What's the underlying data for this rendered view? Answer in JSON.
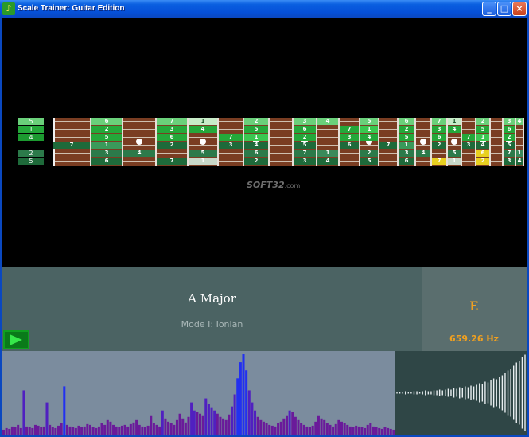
{
  "window": {
    "title": "Scale Trainer: Guitar Edition",
    "minimize": "_",
    "maximize": "□",
    "close": "×",
    "icon": "trainer-app-icon"
  },
  "scale": {
    "name": "A Major",
    "mode": "Mode I: Ionian"
  },
  "note": {
    "letter": "E",
    "frequency": "659.26 Hz"
  },
  "watermark": {
    "brand": "SOFT32",
    "suffix": ".com"
  },
  "legend": [
    "5",
    "1",
    "4",
    "",
    "2",
    "5"
  ],
  "fret_positions": [
    0,
    48,
    88,
    130,
    170,
    208,
    240,
    272,
    302,
    332,
    360,
    386,
    410,
    434,
    456,
    476,
    496,
    514,
    532,
    550,
    566,
    582,
    592
  ],
  "fretboard": [
    [
      "5",
      "",
      "6",
      "",
      "7",
      "1",
      "",
      "2",
      "",
      "3",
      "4",
      "",
      "5",
      "",
      "6",
      "",
      "7",
      "1",
      "",
      "2",
      "",
      "3",
      "4"
    ],
    [
      "1",
      "",
      "2",
      "",
      "3",
      "4",
      "",
      "5",
      "",
      "6",
      "",
      "7",
      "1",
      "",
      "2",
      "",
      "3",
      "4",
      "",
      "5",
      "",
      "6",
      ""
    ],
    [
      "4",
      "",
      "5",
      "",
      "6",
      "",
      "7",
      "1",
      "",
      "2",
      "",
      "3",
      "4",
      "",
      "5",
      "",
      "6",
      "",
      "7",
      "1",
      "",
      "2",
      ""
    ],
    [
      "",
      "7",
      "1",
      "",
      "2",
      "",
      "3",
      "4",
      "",
      "5",
      "",
      "6",
      "",
      "7",
      "1",
      "",
      "2",
      "",
      "3",
      "4",
      "",
      "5",
      ""
    ],
    [
      "2",
      "",
      "3",
      "4",
      "",
      "5",
      "",
      "6",
      "",
      "7",
      "1",
      "",
      "2",
      "",
      "3",
      "4",
      "",
      "5",
      "",
      "6",
      "",
      "7",
      "1"
    ],
    [
      "5",
      "",
      "6",
      "",
      "7",
      "1",
      "",
      "2",
      "",
      "3",
      "4",
      "",
      "5",
      "",
      "6",
      "",
      "7",
      "1",
      "",
      "2",
      "",
      "3",
      "4"
    ]
  ],
  "colors": {
    "fretboard_bg": "#7a3d22",
    "note_green": "#24a83a",
    "note_light": "#6ad07a",
    "note_pale": "#c8ecc8",
    "note_dark": "#1e6a3a",
    "highlight_yellow": "#e8d020",
    "accent_orange": "#f0a020",
    "spectrum_bar": "#6a1a9a",
    "spectrum_peak": "#2230f0"
  },
  "spectrum": [
    6,
    8,
    7,
    10,
    9,
    12,
    8,
    55,
    10,
    9,
    8,
    12,
    11,
    9,
    10,
    40,
    12,
    9,
    8,
    11,
    14,
    60,
    12,
    10,
    9,
    8,
    11,
    9,
    10,
    13,
    12,
    9,
    8,
    10,
    14,
    12,
    18,
    16,
    12,
    10,
    9,
    11,
    12,
    10,
    13,
    15,
    18,
    12,
    10,
    9,
    11,
    24,
    14,
    12,
    10,
    30,
    20,
    16,
    14,
    12,
    18,
    26,
    20,
    15,
    22,
    40,
    30,
    28,
    26,
    24,
    45,
    38,
    34,
    30,
    26,
    22,
    20,
    18,
    25,
    35,
    50,
    70,
    90,
    100,
    80,
    55,
    40,
    30,
    22,
    18,
    16,
    14,
    12,
    11,
    10,
    14,
    16,
    20,
    24,
    30,
    28,
    22,
    18,
    14,
    12,
    10,
    9,
    11,
    16,
    24,
    20,
    18,
    14,
    12,
    10,
    13,
    18,
    16,
    14,
    12,
    10,
    9,
    11,
    10,
    9,
    8,
    12,
    14,
    10,
    9,
    8,
    7,
    9,
    8,
    7,
    6
  ],
  "waveform": [
    1,
    1,
    1,
    2,
    1,
    1,
    2,
    2,
    1,
    2,
    3,
    2,
    2,
    3,
    3,
    4,
    3,
    4,
    5,
    4,
    6,
    5,
    7,
    6,
    8,
    7,
    9,
    8,
    10,
    12,
    11,
    14,
    13,
    16,
    18,
    17,
    20,
    22,
    25,
    28,
    30,
    34,
    38,
    40,
    45,
    48
  ]
}
